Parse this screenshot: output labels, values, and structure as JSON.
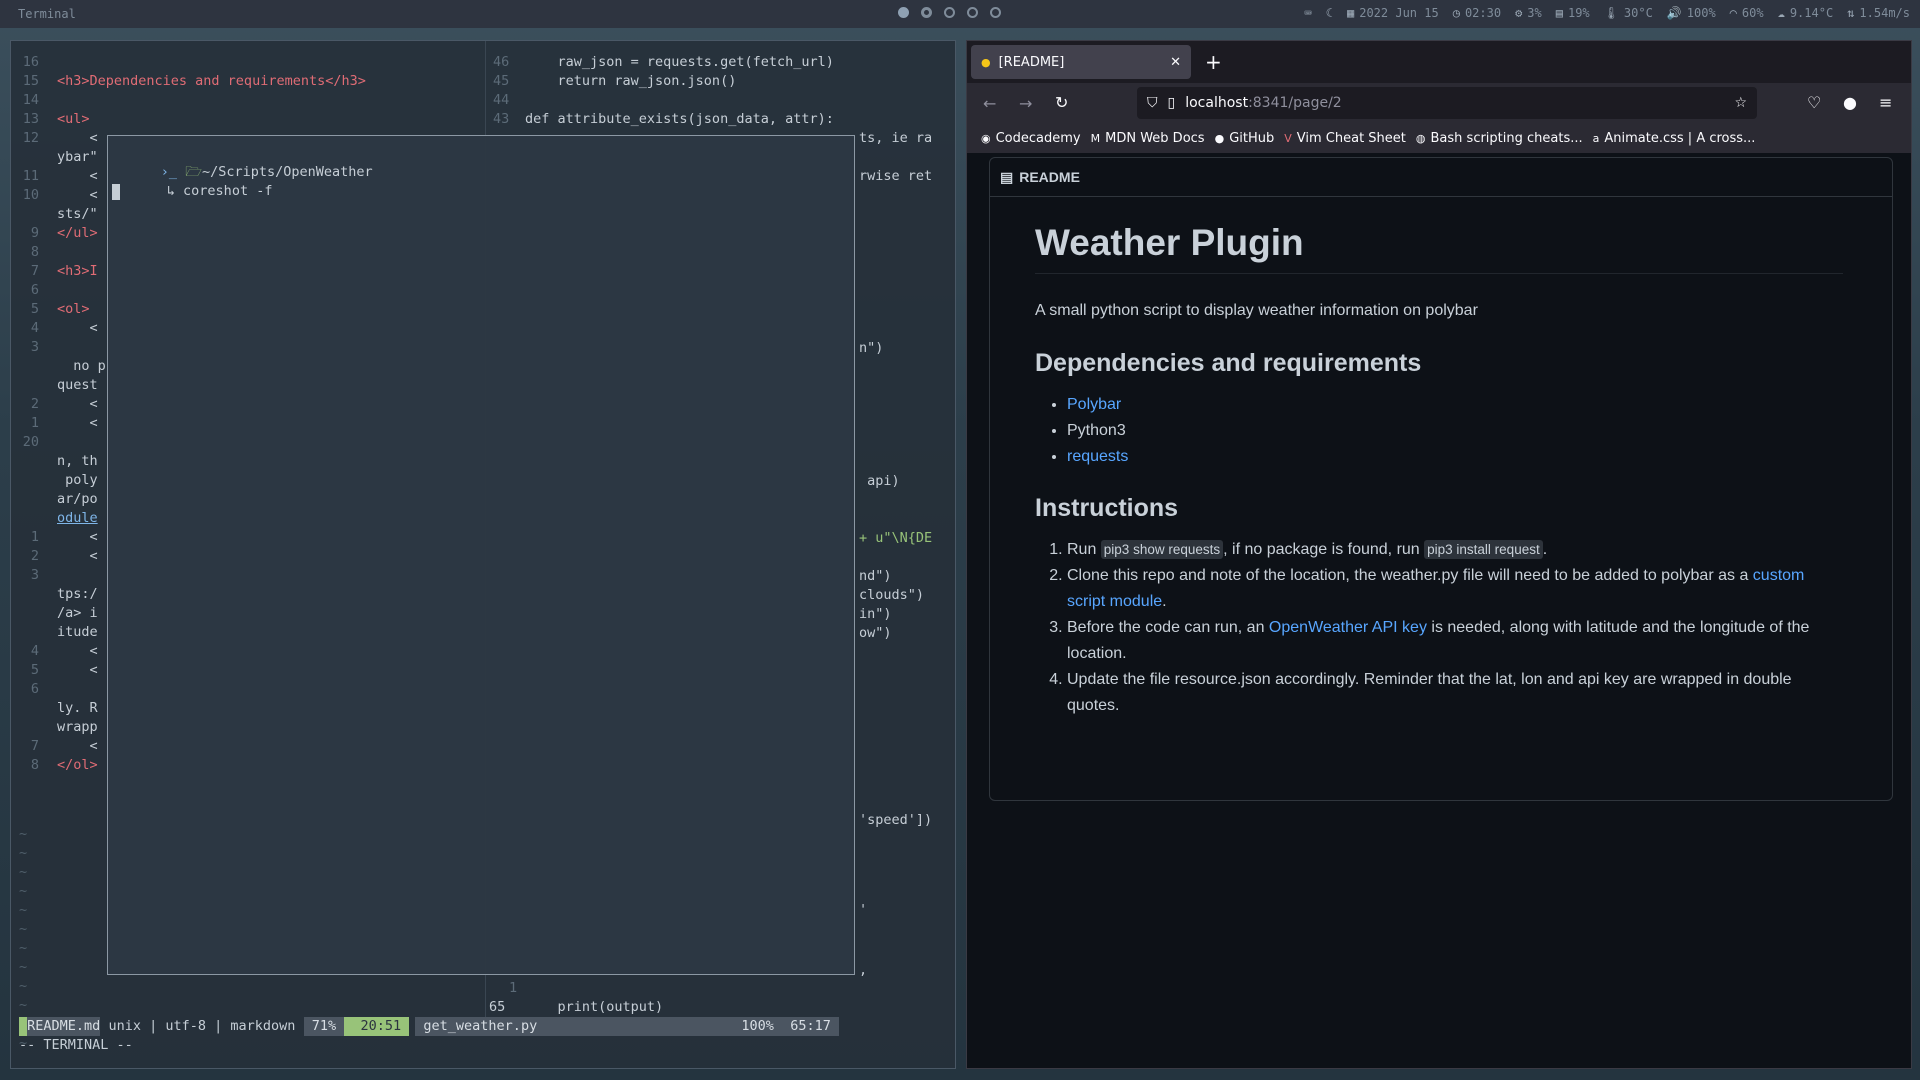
{
  "topbar": {
    "title": "Terminal",
    "date": "2022 Jun 15",
    "time": "02:30",
    "cpu": "3%",
    "ram": "19%",
    "temp": "30°C",
    "volume": "100%",
    "wifi": "60%",
    "weather": "9.14°C",
    "network": "1.54m/s"
  },
  "editor_left": {
    "lines": [
      {
        "num": "16",
        "code": ""
      },
      {
        "num": "15",
        "code": "<h3>Dependencies and requirements</h3>"
      },
      {
        "num": "14",
        "code": ""
      },
      {
        "num": "13",
        "code": "<ul>"
      },
      {
        "num": "12",
        "code": "    <"
      },
      {
        "num": "",
        "code": "ybar\""
      },
      {
        "num": "11",
        "code": "    <"
      },
      {
        "num": "10",
        "code": "    <"
      },
      {
        "num": "",
        "code": "sts/\""
      },
      {
        "num": "9",
        "code": "</ul>"
      },
      {
        "num": "8",
        "code": ""
      },
      {
        "num": "7",
        "code": "<h3>I"
      },
      {
        "num": "6",
        "code": ""
      },
      {
        "num": "5",
        "code": "<ol>"
      },
      {
        "num": "4",
        "code": "    <"
      },
      {
        "num": "3",
        "code": ""
      },
      {
        "num": "",
        "code": "  no p"
      },
      {
        "num": "",
        "code": "quest"
      },
      {
        "num": "2",
        "code": "    <"
      },
      {
        "num": "1",
        "code": "    <"
      },
      {
        "num": "20",
        "code": ""
      },
      {
        "num": "",
        "code": "n, th"
      },
      {
        "num": "",
        "code": " poly"
      },
      {
        "num": "",
        "code": "ar/po"
      },
      {
        "num": "",
        "code": "odule"
      },
      {
        "num": "1",
        "code": "    <"
      },
      {
        "num": "2",
        "code": "    <"
      },
      {
        "num": "3",
        "code": ""
      },
      {
        "num": "",
        "code": "tps:/"
      },
      {
        "num": "",
        "code": "/a> i"
      },
      {
        "num": "",
        "code": "itude"
      },
      {
        "num": "4",
        "code": "    <"
      },
      {
        "num": "5",
        "code": "    <"
      },
      {
        "num": "6",
        "code": ""
      },
      {
        "num": "",
        "code": "ly. R"
      },
      {
        "num": "",
        "code": "wrapp"
      },
      {
        "num": "7",
        "code": "    <"
      },
      {
        "num": "8",
        "code": "</ol>"
      }
    ]
  },
  "editor_right": {
    "lines_top": [
      {
        "num": "46",
        "code": "    raw_json = requests.get(fetch_url)"
      },
      {
        "num": "45",
        "code": "    return raw_json.json()"
      },
      {
        "num": "44",
        "code": ""
      },
      {
        "num": "43",
        "code": "def attribute_exists(json_data, attr):"
      }
    ],
    "fragments": [
      "ts, ie ra",
      "rwise ret",
      "n\")",
      " api)",
      "+ u\"\\N{DE",
      "nd\")",
      "clouds\")",
      "in\")",
      "ow\")",
      "'speed'])",
      "'",
      ","
    ],
    "bottom_num_1": "1",
    "bottom_num_65": "65",
    "bottom_code": "    print(output)"
  },
  "popup": {
    "path": "~/Scripts/OpenWeather",
    "command": "coreshot -f"
  },
  "statusbar": {
    "left_file": "README.md",
    "fileformat": "unix",
    "encoding": "utf-8",
    "filetype": "markdown",
    "percent": "71%",
    "position": "20:51",
    "right_file": "get_weather.py",
    "right_percent": "100%",
    "right_position": "65:17",
    "mode": "-- TERMINAL --"
  },
  "browser": {
    "tab_title": "[README]",
    "url_host": "localhost",
    "url_rest": ":8341/page/2",
    "bookmarks": [
      "Codecademy",
      "MDN Web Docs",
      "GitHub",
      "Vim Cheat Sheet",
      "Bash scripting cheats...",
      "Animate.css | A cross..."
    ],
    "readme_label": "README"
  },
  "readme": {
    "title": "Weather Plugin",
    "intro": "A small python script to display weather information on polybar",
    "deps_heading": "Dependencies and requirements",
    "deps": [
      "Polybar",
      "Python3",
      "requests"
    ],
    "instr_heading": "Instructions",
    "step1_a": "Run ",
    "step1_code1": "pip3 show requests",
    "step1_b": ", if no package is found, run ",
    "step1_code2": "pip3 install request",
    "step1_c": ".",
    "step2_a": "Clone this repo and note of the location, the weather.py file will need to be added to polybar as a ",
    "step2_link": "custom script module",
    "step2_b": ".",
    "step3_a": "Before the code can run, an ",
    "step3_link": "OpenWeather API key",
    "step3_b": " is needed, along with latitude and the longitude of the location.",
    "step4": "Update the file resource.json accordingly. Reminder that the lat, lon and api key are wrapped in double quotes."
  },
  "colors": {
    "accent_link": "#58a6ff",
    "status_green": "#98c379",
    "html_tag": "#e06c75"
  }
}
